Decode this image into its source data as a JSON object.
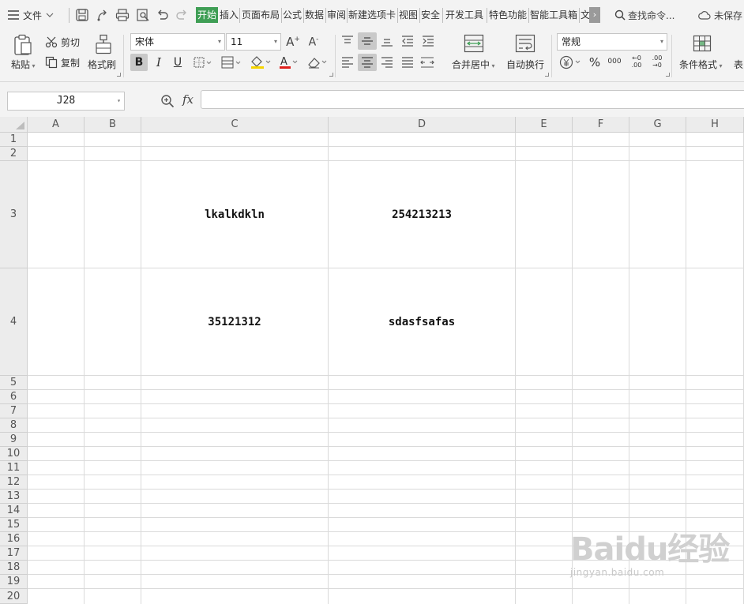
{
  "menubar": {
    "file_label": "文件",
    "tabs": [
      "开始",
      "插入",
      "页面布局",
      "公式",
      "数据",
      "审阅",
      "新建选项卡",
      "视图",
      "安全",
      "开发工具",
      "特色功能",
      "智能工具箱",
      "文"
    ],
    "more_label": "›",
    "search_label": "查找命令...",
    "unsaved_label": "未保存"
  },
  "ribbon": {
    "paste_label": "粘贴",
    "cut_label": "剪切",
    "copy_label": "复制",
    "format_painter_label": "格式刷",
    "font_name": "宋体",
    "font_size": "11",
    "bold": "B",
    "italic": "I",
    "underline": "U",
    "merge_center_label": "合并居中",
    "wrap_text_label": "自动换行",
    "number_format": "常规",
    "percent": "%",
    "thousands": "000",
    "inc_decimal": "←0 .00",
    "dec_decimal": ".00 →0",
    "conditional_format_label": "条件格式",
    "table_style_label": "表"
  },
  "formula_bar": {
    "name_box": "J28",
    "fx_label": "fx",
    "formula": ""
  },
  "sheet": {
    "columns": [
      "A",
      "B",
      "C",
      "D",
      "E",
      "F",
      "G",
      "H"
    ],
    "rows": [
      "1",
      "2",
      "3",
      "4",
      "5",
      "6",
      "7",
      "8",
      "9",
      "10",
      "11",
      "12",
      "13",
      "14",
      "15",
      "16",
      "17",
      "18",
      "19",
      "20"
    ],
    "cells": {
      "C3": "lkalkdkln",
      "D3": "254213213",
      "C4": "35121312",
      "D4": "sdasfsafas"
    }
  },
  "watermark": {
    "brand": "Baidu经验",
    "url": "jingyan.baidu.com"
  },
  "colors": {
    "active_tab": "#3f9e55",
    "font_color_underline": "#e0201c",
    "fill_color_underline": "#f5d400"
  }
}
